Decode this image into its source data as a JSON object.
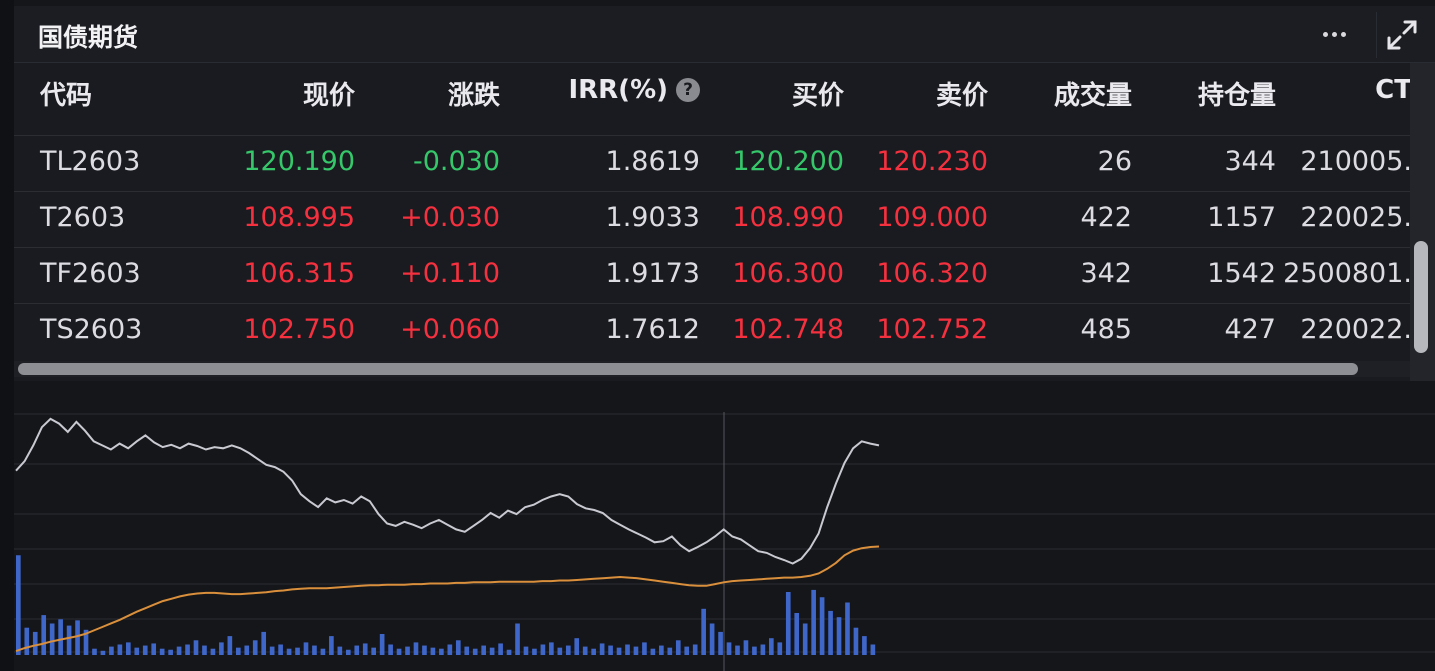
{
  "panel": {
    "title": "国债期货"
  },
  "header_icons": {
    "more": "more-dots-icon",
    "expand": "expand-icon"
  },
  "table": {
    "headers": {
      "code": "代码",
      "price": "现价",
      "change": "涨跌",
      "irr": "IRR(%)",
      "bid": "买价",
      "ask": "卖价",
      "volume": "成交量",
      "open_interest": "持仓量",
      "ctd": "CT"
    },
    "help_symbol": "?",
    "rows": [
      {
        "code": "TL2603",
        "price": "120.190",
        "change": "-0.030",
        "irr": "1.8619",
        "bid": "120.200",
        "ask": "120.230",
        "volume": "26",
        "open_interest": "344",
        "ctd": "210005.",
        "trend": "down"
      },
      {
        "code": "T2603",
        "price": "108.995",
        "change": "+0.030",
        "irr": "1.9033",
        "bid": "108.990",
        "ask": "109.000",
        "volume": "422",
        "open_interest": "1157",
        "ctd": "220025.",
        "trend": "up"
      },
      {
        "code": "TF2603",
        "price": "106.315",
        "change": "+0.110",
        "irr": "1.9173",
        "bid": "106.300",
        "ask": "106.320",
        "volume": "342",
        "open_interest": "1542",
        "ctd": "2500801.",
        "trend": "up"
      },
      {
        "code": "TS2603",
        "price": "102.750",
        "change": "+0.060",
        "irr": "1.7612",
        "bid": "102.748",
        "ask": "102.752",
        "volume": "485",
        "open_interest": "427",
        "ctd": "220022.",
        "trend": "up"
      }
    ]
  },
  "colors": {
    "up": "#f5303f",
    "down": "#35c76a",
    "price_line": "#c9c9d2",
    "avg_line": "#d98f3c",
    "volume_bar": "#3f66c9",
    "grid": "#2a2c33"
  },
  "chart_data": {
    "type": "line",
    "series": [
      {
        "values": [
          0.12,
          0.28,
          0.55,
          0.86,
          1.0,
          0.92,
          0.78,
          0.95,
          0.8,
          0.62,
          0.55,
          0.48,
          0.58,
          0.5,
          0.62,
          0.72,
          0.6,
          0.52,
          0.56,
          0.5,
          0.58,
          0.54,
          0.48,
          0.52,
          0.5,
          0.55,
          0.5,
          0.42,
          0.32,
          0.22,
          0.18,
          0.1,
          -0.05,
          -0.28,
          -0.4,
          -0.5,
          -0.35,
          -0.42,
          -0.38,
          -0.44,
          -0.32,
          -0.4,
          -0.62,
          -0.78,
          -0.82,
          -0.75,
          -0.8,
          -0.86,
          -0.78,
          -0.72,
          -0.8,
          -0.88,
          -0.92,
          -0.82,
          -0.72,
          -0.6,
          -0.68,
          -0.56,
          -0.62,
          -0.5,
          -0.46,
          -0.38,
          -0.32,
          -0.28,
          -0.32,
          -0.45,
          -0.52,
          -0.55,
          -0.6,
          -0.72,
          -0.8,
          -0.88,
          -0.95,
          -1.02,
          -1.1,
          -1.08,
          -1.0,
          -1.15,
          -1.25,
          -1.18,
          -1.1,
          -1.0,
          -0.88,
          -1.0,
          -1.05,
          -1.15,
          -1.25,
          -1.28,
          -1.35,
          -1.4,
          -1.46,
          -1.38,
          -1.2,
          -0.95,
          -0.5,
          -0.1,
          0.25,
          0.5,
          0.62,
          0.58,
          0.55
        ]
      },
      {
        "values": [
          -2.95,
          -2.9,
          -2.86,
          -2.83,
          -2.79,
          -2.76,
          -2.73,
          -2.7,
          -2.66,
          -2.6,
          -2.54,
          -2.48,
          -2.42,
          -2.35,
          -2.28,
          -2.22,
          -2.16,
          -2.1,
          -2.06,
          -2.02,
          -1.99,
          -1.97,
          -1.96,
          -1.96,
          -1.97,
          -1.98,
          -1.98,
          -1.97,
          -1.96,
          -1.95,
          -1.93,
          -1.92,
          -1.9,
          -1.89,
          -1.88,
          -1.88,
          -1.88,
          -1.87,
          -1.86,
          -1.85,
          -1.84,
          -1.83,
          -1.83,
          -1.82,
          -1.82,
          -1.82,
          -1.81,
          -1.81,
          -1.8,
          -1.8,
          -1.8,
          -1.79,
          -1.79,
          -1.78,
          -1.78,
          -1.78,
          -1.77,
          -1.77,
          -1.77,
          -1.77,
          -1.77,
          -1.76,
          -1.76,
          -1.75,
          -1.75,
          -1.74,
          -1.73,
          -1.72,
          -1.71,
          -1.7,
          -1.69,
          -1.7,
          -1.71,
          -1.73,
          -1.75,
          -1.77,
          -1.79,
          -1.81,
          -1.83,
          -1.84,
          -1.84,
          -1.81,
          -1.78,
          -1.76,
          -1.75,
          -1.74,
          -1.73,
          -1.72,
          -1.71,
          -1.7,
          -1.7,
          -1.69,
          -1.67,
          -1.63,
          -1.55,
          -1.45,
          -1.32,
          -1.24,
          -1.2,
          -1.18,
          -1.17
        ]
      }
    ],
    "volume": [
      95,
      26,
      22,
      38,
      30,
      34,
      28,
      33,
      24,
      6,
      4,
      8,
      10,
      12,
      7,
      9,
      11,
      6,
      5,
      8,
      10,
      14,
      9,
      6,
      12,
      18,
      7,
      9,
      14,
      22,
      8,
      10,
      6,
      7,
      12,
      9,
      6,
      18,
      8,
      5,
      9,
      11,
      7,
      20,
      10,
      6,
      8,
      12,
      9,
      7,
      6,
      10,
      14,
      8,
      6,
      9,
      7,
      11,
      5,
      30,
      8,
      6,
      10,
      12,
      7,
      9,
      16,
      8,
      6,
      11,
      9,
      7,
      10,
      8,
      12,
      6,
      9,
      7,
      14,
      8,
      10,
      44,
      30,
      22,
      12,
      9,
      14,
      8,
      10,
      16,
      12,
      60,
      40,
      30,
      62,
      55,
      42,
      36,
      50,
      26,
      18,
      10
    ]
  }
}
